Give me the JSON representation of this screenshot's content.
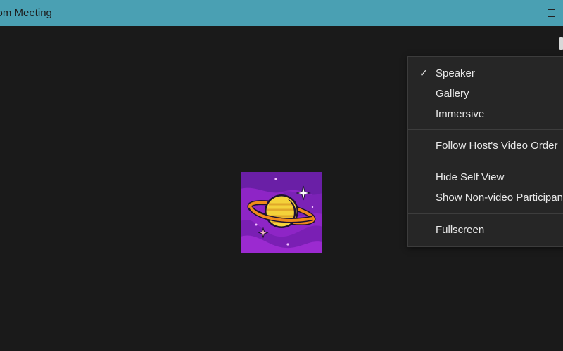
{
  "window": {
    "title": "Zoom Meeting",
    "minimize_icon": "minimize-icon",
    "maximize_icon": "maximize-icon"
  },
  "avatar": {
    "description_icon": "saturn-planet-avatar",
    "bg_color": "#8a24c4"
  },
  "menu": {
    "items": [
      {
        "label": "Speaker",
        "checked": true
      },
      {
        "label": "Gallery",
        "checked": false
      },
      {
        "label": "Immersive",
        "checked": false
      },
      {
        "label": "Follow Host's Video Order",
        "checked": false
      },
      {
        "label": "Hide Self View",
        "checked": false
      },
      {
        "label": "Show Non-video Participants",
        "checked": false
      },
      {
        "label": "Fullscreen",
        "checked": false
      }
    ],
    "check_glyph": "✓"
  },
  "colors": {
    "titlebar": "#4aa0b3",
    "background": "#1a1a1a",
    "menu_bg": "#262626"
  }
}
